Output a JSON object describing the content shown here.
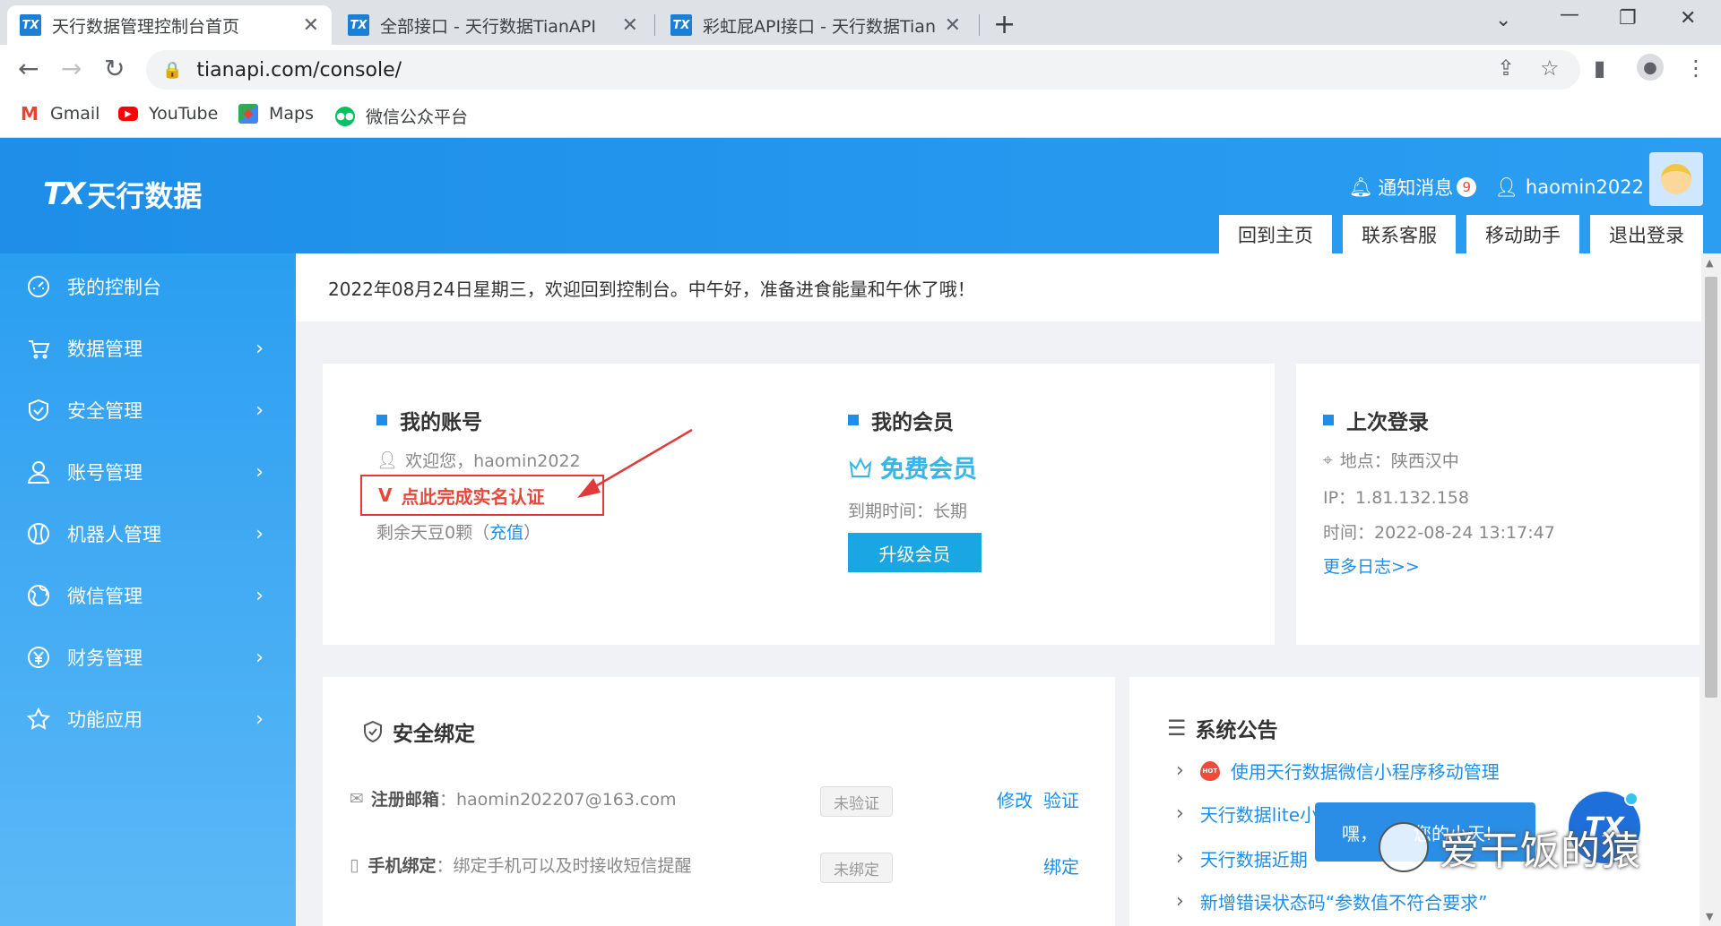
{
  "browser": {
    "tabs": [
      {
        "title": "天行数据管理控制台首页",
        "favicon": "TX"
      },
      {
        "title": "全部接口 - 天行数据TianAPI",
        "favicon": "TX"
      },
      {
        "title": "彩虹屁API接口 - 天行数据TianAPI",
        "favicon": "TX"
      }
    ],
    "url": "tianapi.com/console/",
    "bookmarks": [
      {
        "label": "Gmail",
        "icon": "gmail-icon"
      },
      {
        "label": "YouTube",
        "icon": "youtube-icon"
      },
      {
        "label": "Maps",
        "icon": "maps-icon"
      },
      {
        "label": "微信公众平台",
        "icon": "wechat-icon"
      }
    ]
  },
  "header": {
    "logo_mark": "TX",
    "logo_text": "天行数据",
    "notify_label": "通知消息",
    "notify_count": "9",
    "username": "haomin2022",
    "buttons": [
      "回到主页",
      "联系客服",
      "移动助手",
      "退出登录"
    ]
  },
  "sidebar": {
    "items": [
      {
        "label": "我的控制台",
        "icon": "dashboard-icon",
        "has_children": false
      },
      {
        "label": "数据管理",
        "icon": "cart-icon",
        "has_children": true
      },
      {
        "label": "安全管理",
        "icon": "shield-icon",
        "has_children": true
      },
      {
        "label": "账号管理",
        "icon": "user-icon",
        "has_children": true
      },
      {
        "label": "机器人管理",
        "icon": "robot-icon",
        "has_children": true
      },
      {
        "label": "微信管理",
        "icon": "globe-icon",
        "has_children": true
      },
      {
        "label": "财务管理",
        "icon": "yen-icon",
        "has_children": true
      },
      {
        "label": "功能应用",
        "icon": "star-icon",
        "has_children": true
      }
    ]
  },
  "greeting": "2022年08月24日星期三，欢迎回到控制台。中午好，准备进食能量和午休了哦！",
  "account": {
    "title": "我的账号",
    "welcome": "欢迎您，haomin2022",
    "verify_mark": "V",
    "verify_link": "点此完成实名认证",
    "beans_prefix": "剩余天豆0颗（",
    "recharge": "充值",
    "beans_suffix": "）"
  },
  "membership": {
    "title": "我的会员",
    "level": "免费会员",
    "expire": "到期时间：长期",
    "upgrade_button": "升级会员"
  },
  "last_login": {
    "title": "上次登录",
    "location": "地点：陕西汉中",
    "ip": "IP：1.81.132.158",
    "time": "时间：2022-08-24 13:17:47",
    "more": "更多日志>>"
  },
  "security": {
    "title": "安全绑定",
    "rows": [
      {
        "label": "注册邮箱",
        "value": "：haomin202207@163.com",
        "status": "未验证",
        "actions": [
          "修改",
          "验证"
        ]
      },
      {
        "label": "手机绑定",
        "value": "：绑定手机可以及时接收短信提醒",
        "status": "未绑定",
        "actions": [
          "绑定"
        ]
      }
    ]
  },
  "notices": {
    "title": "系统公告",
    "hot_label": "HOT",
    "items": [
      {
        "text": "使用天行数据微信小程序移动管理",
        "hot": true
      },
      {
        "text": "天行数据lite小",
        "hot": false
      },
      {
        "text": "天行数据近期",
        "hot": false
      },
      {
        "text": "新增错误状态码“参数值不符合要求”",
        "hot": false
      }
    ]
  },
  "chat": {
    "popup_text": "嘿，",
    "popup_text2": "您的小天!",
    "logo_mark": "TX"
  },
  "watermark": "爱干饭的猿"
}
